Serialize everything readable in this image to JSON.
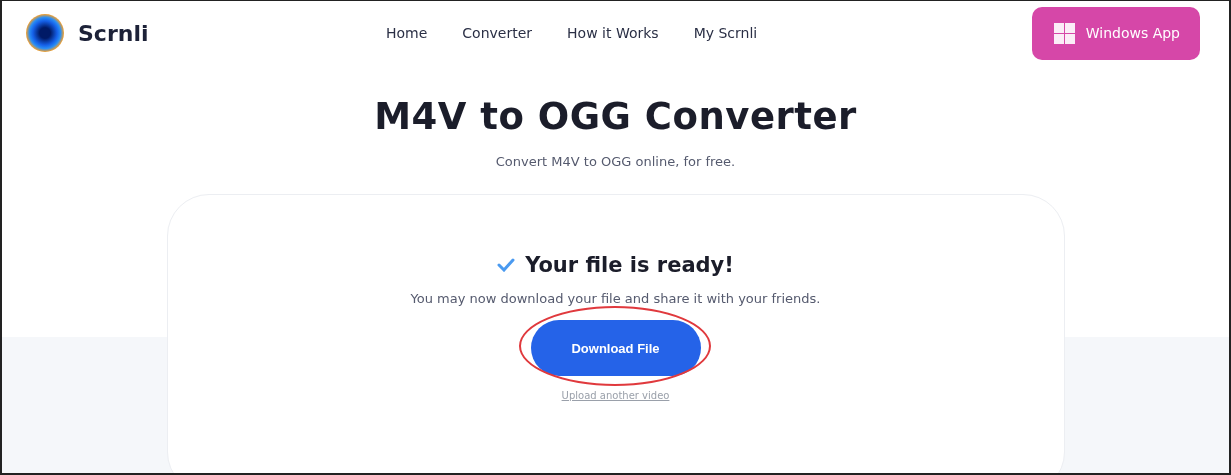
{
  "header": {
    "brand": "Scrnli",
    "nav": [
      {
        "label": "Home"
      },
      {
        "label": "Converter"
      },
      {
        "label": "How it Works"
      },
      {
        "label": "My Scrnli"
      }
    ],
    "app_button": "Windows App"
  },
  "hero": {
    "title": "M4V to OGG Converter",
    "subtitle": "Convert M4V to OGG online, for free."
  },
  "card": {
    "title": "Your file is ready!",
    "message": "You may now download your file and share it with your friends.",
    "download_button": "Download File",
    "highlighted": true,
    "upload_link": "Upload another video"
  }
}
